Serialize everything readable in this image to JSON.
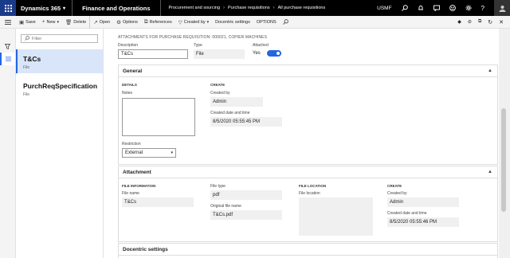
{
  "topbar": {
    "brand": "Dynamics 365",
    "app_name": "Finance and Operations",
    "breadcrumbs": [
      "Procurement and sourcing",
      "Purchase requisitions",
      "All purchase requisitions"
    ],
    "company": "USMF"
  },
  "toolbar": {
    "save": "Save",
    "new": "New",
    "delete": "Delete",
    "open": "Open",
    "options1": "Options",
    "references": "References",
    "created_by": "Created by",
    "docentric": "Docentric settings",
    "options2": "OPTIONS"
  },
  "list": {
    "filter_placeholder": "Filter",
    "items": [
      {
        "name": "T&Cs",
        "type": "File"
      },
      {
        "name": "PurchReqSpecification",
        "type": "File"
      }
    ]
  },
  "page": {
    "caption": "ATTACHMENTS FOR PURCHASE REQUISITION: 000021, COPIER MACHINES",
    "description_label": "Description",
    "description_value": "T&Cs",
    "type_label": "Type",
    "type_value": "File",
    "attached_label": "Attached",
    "attached_value": "Yes"
  },
  "general": {
    "title": "General",
    "details_heading": "DETAILS",
    "notes_label": "Notes",
    "restriction_label": "Restriction",
    "restriction_value": "External",
    "create_heading": "CREATE",
    "created_by_label": "Created by",
    "created_by_value": "Admin",
    "created_dt_label": "Created date and time",
    "created_dt_value": "8/5/2020 05:55:45 PM"
  },
  "attachment": {
    "title": "Attachment",
    "file_info_heading": "FILE INFORMATION",
    "file_name_label": "File name",
    "file_name_value": "T&Cs",
    "file_type_label": "File type",
    "file_type_value": "pdf",
    "orig_name_label": "Original file name",
    "orig_name_value": "T&Cs.pdf",
    "file_loc_heading": "FILE LOCATION",
    "file_loc_label": "File location",
    "create_heading": "CREATE",
    "created_by_label": "Created by",
    "created_by_value": "Admin",
    "created_dt_label": "Created date and time",
    "created_dt_value": "8/5/2020 05:55:46 PM"
  },
  "docentric_section": {
    "title": "Docentric settings"
  },
  "colors": {
    "accent": "#2266e3",
    "topbar": "#000000",
    "selected_row": "#d9e5f9"
  }
}
